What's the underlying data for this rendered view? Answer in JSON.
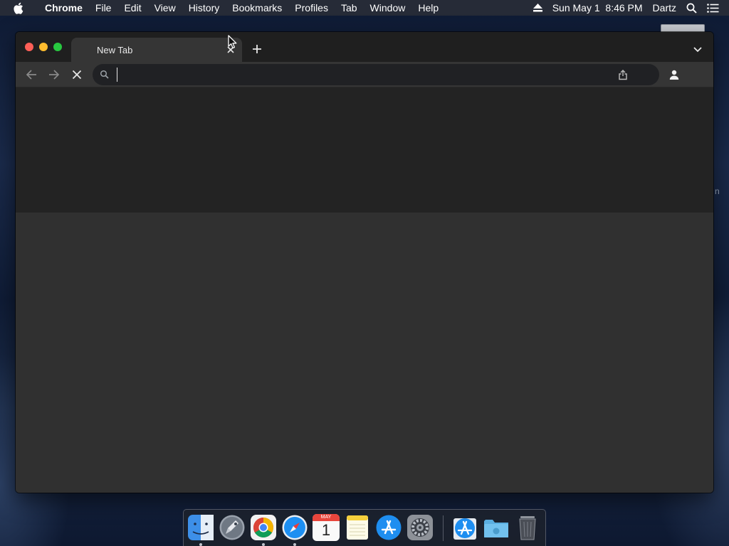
{
  "menubar": {
    "app_name": "Chrome",
    "items": [
      "File",
      "Edit",
      "View",
      "History",
      "Bookmarks",
      "Profiles",
      "Tab",
      "Window",
      "Help"
    ],
    "date_time": "Sun May 1  8:46 PM",
    "user": "Dartz"
  },
  "browser": {
    "tab_title": "New Tab",
    "omnibox_value": "",
    "accent_colors": {
      "close": "#fe5f57",
      "minimize": "#febc2e",
      "maximize": "#28c840"
    }
  },
  "dock": {
    "calendar_month": "MAY",
    "calendar_day": "1",
    "apps": [
      "finder-icon",
      "launchpad-icon",
      "chrome-icon",
      "safari-icon",
      "calendar-icon",
      "notes-icon",
      "app-store-icon",
      "system-preferences-icon",
      "app-store-folder-icon",
      "downloads-folder-icon",
      "trash-icon"
    ]
  },
  "desktop": {
    "partial_label": "n"
  }
}
